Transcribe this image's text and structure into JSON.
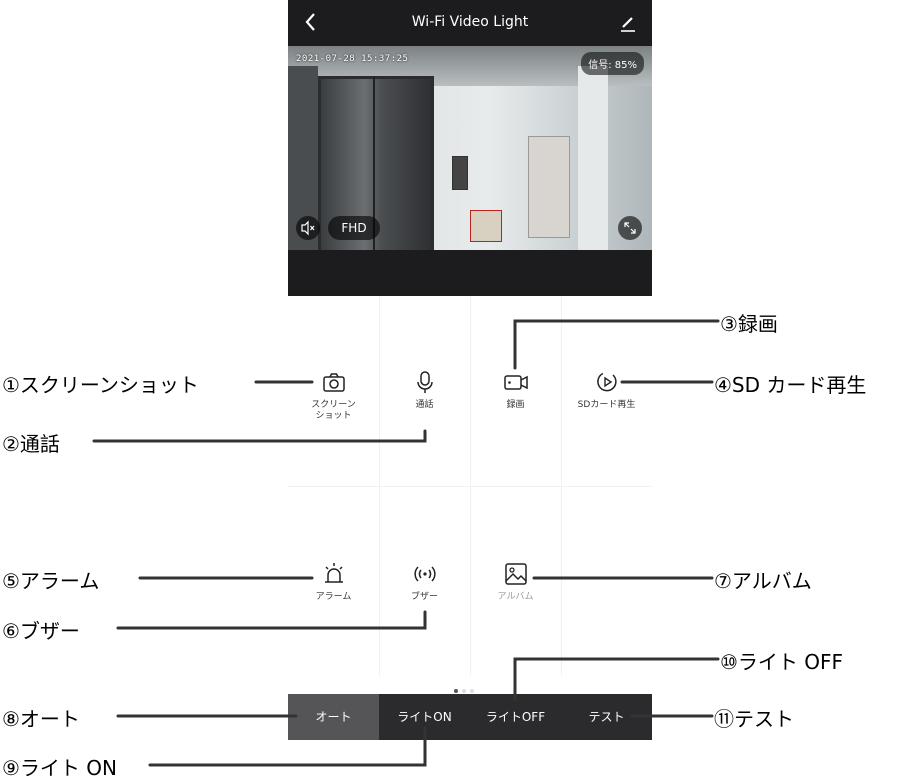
{
  "header": {
    "back_icon": "chevron-left-icon",
    "title": "Wi-Fi Video Light",
    "edit_icon": "pencil-icon"
  },
  "video": {
    "timestamp": "2021-07-28 15:37:25",
    "signal": "信号: 85%",
    "mute_icon": "speaker-mute-icon",
    "quality": "FHD",
    "fullscreen_icon": "fullscreen-icon"
  },
  "grid": {
    "items": [
      {
        "label": "スクリーン\nショット",
        "icon": "camera-icon"
      },
      {
        "label": "通話",
        "icon": "microphone-icon"
      },
      {
        "label": "録画",
        "icon": "video-camera-icon"
      },
      {
        "label": "SDカード再生",
        "icon": "play-circle-icon"
      },
      {
        "label": "アラーム",
        "icon": "alarm-light-icon"
      },
      {
        "label": "ブザー",
        "icon": "wireless-signal-icon"
      },
      {
        "label": "アルバム",
        "icon": "image-icon"
      }
    ]
  },
  "bottom_bar": {
    "buttons": [
      "オート",
      "ライトON",
      "ライトOFF",
      "テスト"
    ],
    "active_index": 0
  },
  "annotations": {
    "screenshot": "①スクリーンショット",
    "call": "②通話",
    "record": "③録画",
    "sd_playback": "④SD カード再生",
    "alarm": "⑤アラーム",
    "buzzer": "⑥ブザー",
    "album": "⑦アルバム",
    "auto": "⑧オート",
    "light_on": "⑨ライト ON",
    "light_off": "⑩ライト OFF",
    "test": "⑪テスト"
  }
}
